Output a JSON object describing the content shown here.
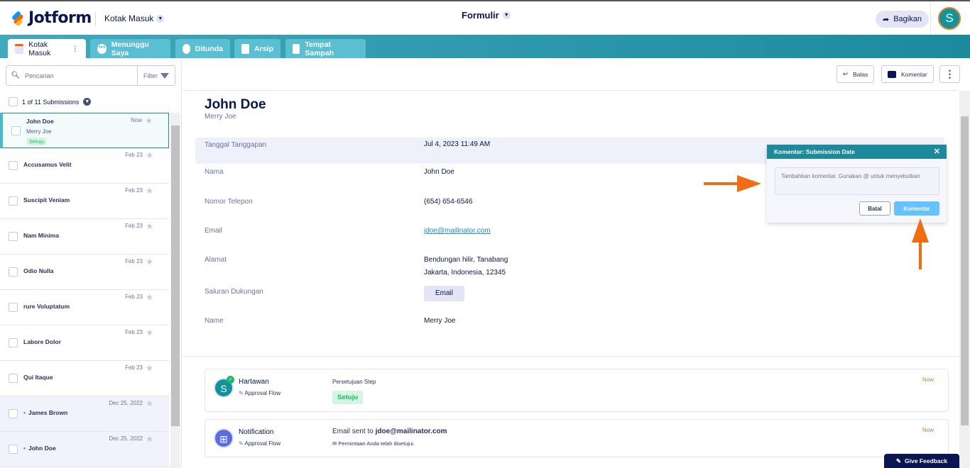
{
  "header": {
    "brand": "Jotform",
    "inbox_label": "Kotak Masuk",
    "form_title": "Formulir",
    "share_label": "Bagikan",
    "avatar_initial": "S"
  },
  "tabs": [
    {
      "label": "Kotak Masuk"
    },
    {
      "label": "Menunggu Saya"
    },
    {
      "label": "Ditunda"
    },
    {
      "label": "Arsip"
    },
    {
      "label": "Tempat Sampah"
    }
  ],
  "sidebar": {
    "search_placeholder": "Pencarian",
    "filter_label": "Filter",
    "count_label": "1 of 11 Submissions",
    "items": [
      {
        "name": "John Doe",
        "sub": "Merry Joe",
        "badge": "Setuju",
        "date": "Now"
      },
      {
        "name": "Accusamus Velit",
        "date": "Feb 23"
      },
      {
        "name": "Suscipit Veniam",
        "date": "Feb 23"
      },
      {
        "name": "Nam Minima",
        "date": "Feb 23"
      },
      {
        "name": "Odio Nulla",
        "date": "Feb 23"
      },
      {
        "name": "rure Voluptatum",
        "date": "Feb 23"
      },
      {
        "name": "Labore Dolor",
        "date": "Feb 23"
      },
      {
        "name": "Qui Itaque",
        "date": "Feb 23"
      },
      {
        "name": "James Brown",
        "date": "Dec 25, 2022"
      },
      {
        "name": "John Doe",
        "date": "Dec 25, 2022"
      }
    ]
  },
  "toolbar": {
    "reply": "Balas",
    "comment": "Komentar"
  },
  "submission": {
    "title": "John Doe",
    "subtitle": "Merry Joe",
    "fields": [
      {
        "label": "Tanggal Tanggapan",
        "value": "Jul 4, 2023 11:49 AM"
      },
      {
        "label": "Nama",
        "value": "John Doe"
      },
      {
        "label": "Nomor Telepon",
        "value": "(654) 654-6546"
      },
      {
        "label": "Email",
        "value": "jdoe@mailinator.com"
      },
      {
        "label": "Alamat",
        "value": "Bendungan hilir, Tanabang",
        "value2": "Jakarta, Indonesia, 12345"
      },
      {
        "label": "Saluran Dukungan",
        "value": "Email"
      },
      {
        "label": "Name",
        "value": "Merry Joe"
      }
    ]
  },
  "activity": [
    {
      "name": "Hartawan",
      "flow": "Approval Flow",
      "step": "Persetujuan Step",
      "status": "Setuju",
      "time": "Now",
      "initial": "S"
    },
    {
      "name": "Notification",
      "flow": "Approval Flow",
      "prefix": "Email sent to ",
      "email": "jdoe@mailinator.com",
      "message": "Permintaan Anda telah disetujui.",
      "time": "Now"
    }
  ],
  "comment_popup": {
    "title": "Komentar: Submission Date",
    "placeholder": "Tambahkan komentar. Gunakan @ untuk menyebutkan",
    "cancel": "Batal",
    "submit": "Komentar"
  },
  "feedback_label": "Give Feedback",
  "colors": {
    "teal": "#1d8a9c",
    "navy": "#0a1551",
    "orange": "#f26c13",
    "green": "#20b76a"
  }
}
